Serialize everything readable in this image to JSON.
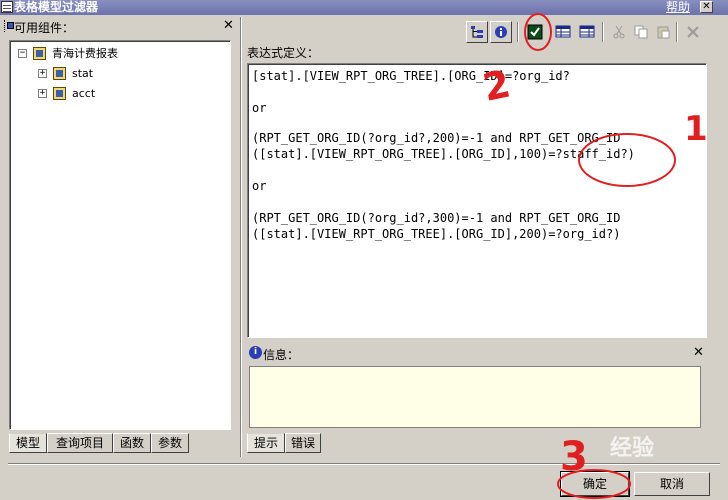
{
  "window": {
    "title": "表格模型过滤器",
    "help_label": "帮助",
    "close_glyph": "✕"
  },
  "left_panel": {
    "header": "可用组件：",
    "close_glyph": "✕",
    "tree": {
      "root": {
        "label": "青海计费报表",
        "expander": "−"
      },
      "children": [
        {
          "label": "stat",
          "expander": "+"
        },
        {
          "label": "acct",
          "expander": "+"
        }
      ]
    },
    "tabs": [
      {
        "label": "模型",
        "active": true
      },
      {
        "label": "查询项目",
        "active": false
      },
      {
        "label": "函数",
        "active": false
      },
      {
        "label": "参数",
        "active": false
      }
    ]
  },
  "expression": {
    "label": "表达式定义：",
    "lines": [
      "[stat].[VIEW_RPT_ORG_TREE].[ORG_ID]=?org_id?",
      "",
      "or",
      "",
      "(RPT_GET_ORG_ID(?org_id?,200)=-1 and RPT_GET_ORG_ID",
      "([stat].[VIEW_RPT_ORG_TREE].[ORG_ID],100)=?staff_id?)",
      "",
      "or",
      "",
      "(RPT_GET_ORG_ID(?org_id?,300)=-1 and RPT_GET_ORG_ID",
      "([stat].[VIEW_RPT_ORG_TREE].[ORG_ID],200)=?org_id?)"
    ]
  },
  "toolbar": {
    "buttons": [
      {
        "icon": "tree-view-icon"
      },
      {
        "icon": "info-icon"
      },
      {
        "icon": "check-icon"
      },
      {
        "icon": "table-icon"
      },
      {
        "icon": "table-alt-icon"
      },
      {
        "icon": "cut-icon"
      },
      {
        "icon": "copy-icon"
      },
      {
        "icon": "paste-icon"
      },
      {
        "icon": "delete-icon"
      }
    ]
  },
  "info": {
    "label": "信息：",
    "icon_glyph": "i",
    "close_glyph": "✕",
    "content": "",
    "tabs": [
      {
        "label": "提示",
        "active": true
      },
      {
        "label": "错误",
        "active": false
      }
    ]
  },
  "buttons": {
    "ok": "确定",
    "cancel": "取消"
  },
  "annotations": {
    "marks": [
      "1",
      "2",
      "3"
    ],
    "color": "#e02020"
  },
  "watermark": "经验"
}
